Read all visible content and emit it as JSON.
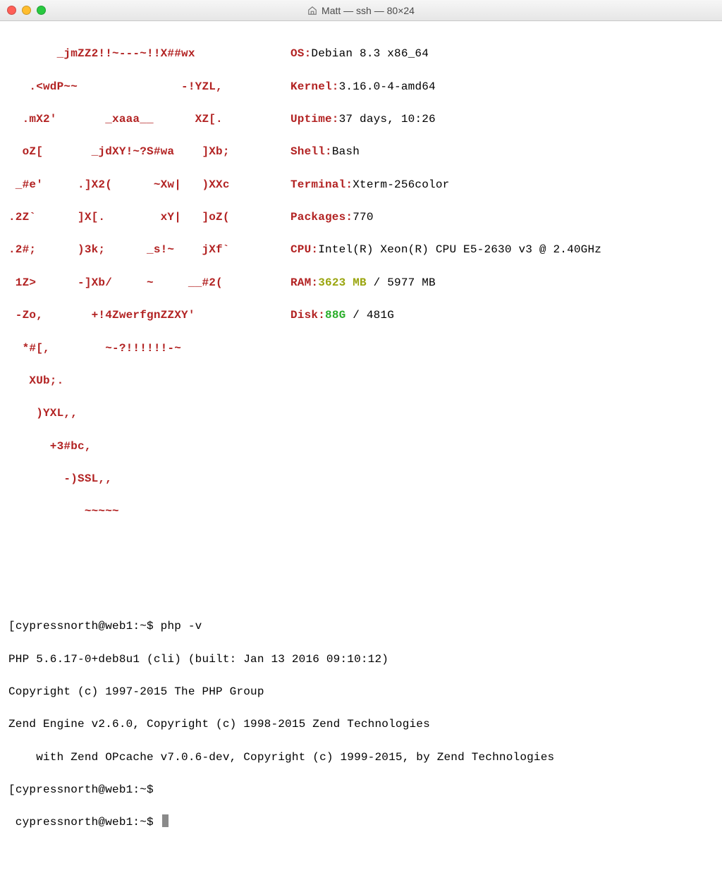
{
  "window": {
    "title": "Matt — ssh — 80×24"
  },
  "ascii": {
    "l01": "       _jmZZ2!!~---~!!X##wx",
    "l02": "   .<wdP~~               -!YZL,",
    "l03": "  .mX2'       _xaaa__      XZ[.",
    "l04": "  oZ[       _jdXY!~?S#wa    ]Xb;",
    "l05": " _#e'     .]X2(      ~Xw|   )XXc",
    "l06": ".2Z`      ]X[.        xY|   ]oZ(",
    "l07": ".2#;      )3k;      _s!~    jXf`",
    "l08": " 1Z>      -]Xb/     ~     __#2(",
    "l09": " -Zo,       +!4ZwerfgnZZXY'",
    "l10": "  *#[,        ~-?!!!!!!-~",
    "l11": "   XUb;.",
    "l12": "    )YXL,,",
    "l13": "      +3#bc,",
    "l14": "        -)SSL,,",
    "l15": "           ~~~~~"
  },
  "info": {
    "os_label": "OS:",
    "os": "Debian 8.3 x86_64",
    "kernel_label": "Kernel:",
    "kernel": "3.16.0-4-amd64",
    "uptime_label": "Uptime:",
    "uptime": "37 days, 10:26",
    "shell_label": "Shell:",
    "shell": "Bash",
    "terminal_label": "Terminal:",
    "terminal": "Xterm-256color",
    "packages_label": "Packages:",
    "packages": "770",
    "cpu_label": "CPU:",
    "cpu": "Intel(R) Xeon(R) CPU E5-2630 v3 @ 2.40GHz",
    "ram_label": "RAM:",
    "ram_used": "3623 MB",
    "ram_sep": " / ",
    "ram_total": "5977 MB",
    "disk_label": "Disk:",
    "disk_used": "88G",
    "disk_sep": " / ",
    "disk_total": "481G"
  },
  "shell": {
    "prompt1_open": "[",
    "prompt1": "cypressnorth@web1:~$ ",
    "cmd1": "php -v",
    "prompt1_close": "]",
    "out1": "PHP 5.6.17-0+deb8u1 (cli) (built: Jan 13 2016 09:10:12)",
    "out2": "Copyright (c) 1997-2015 The PHP Group",
    "out3": "Zend Engine v2.6.0, Copyright (c) 1998-2015 Zend Technologies",
    "out4": "    with Zend OPcache v7.0.6-dev, Copyright (c) 1999-2015, by Zend Technologies",
    "prompt2_open": "[",
    "prompt2": "cypressnorth@web1:~$",
    "prompt2_close": "]",
    "prompt3": " cypressnorth@web1:~$ "
  }
}
